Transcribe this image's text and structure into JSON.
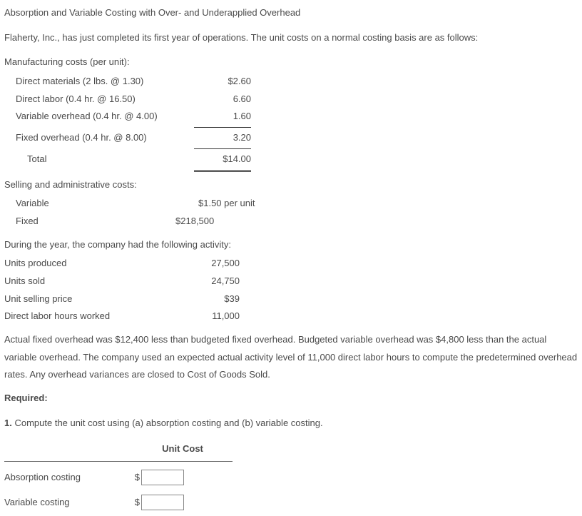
{
  "title": "Absorption and Variable Costing with Over- and Underapplied Overhead",
  "intro": "Flaherty, Inc., has just completed its first year of operations. The unit costs on a normal costing basis are as follows:",
  "mfg_head": "Manufacturing costs (per unit):",
  "mfg": {
    "dm_label": "Direct materials (2 lbs. @ 1.30)",
    "dm_val": "$2.60",
    "dl_label": "Direct labor (0.4 hr. @ 16.50)",
    "dl_val": "6.60",
    "vo_label": "Variable overhead (0.4 hr. @ 4.00)",
    "vo_val": "1.60",
    "fo_label": "Fixed overhead (0.4 hr. @ 8.00)",
    "fo_val": "3.20",
    "total_label": "Total",
    "total_val": "$14.00"
  },
  "sa_head": "Selling and administrative costs:",
  "sa": {
    "var_label": "Variable",
    "var_val": "$1.50 per unit",
    "fix_label": "Fixed",
    "fix_val": "$218,500"
  },
  "activity_head": "During the year, the company had the following activity:",
  "activity": {
    "up_label": "Units produced",
    "up_val": "27,500",
    "us_label": "Units sold",
    "us_val": "24,750",
    "usp_label": "Unit selling price",
    "usp_val": "$39",
    "dlh_label": "Direct labor hours worked",
    "dlh_val": "11,000"
  },
  "para": "Actual fixed overhead was $12,400 less than budgeted fixed overhead. Budgeted variable overhead was $4,800 less than the actual variable overhead. The company used an expected actual activity level of 11,000 direct labor hours to compute the predetermined overhead rates. Any overhead variances are closed to Cost of Goods Sold.",
  "required_label": "Required:",
  "req1": "1. Compute the unit cost using (a) absorption costing and (b) variable costing.",
  "answer": {
    "col_head": "Unit Cost",
    "abs_label": "Absorption costing",
    "var_label": "Variable costing",
    "dollar": "$",
    "abs_value": "",
    "var_value": ""
  }
}
